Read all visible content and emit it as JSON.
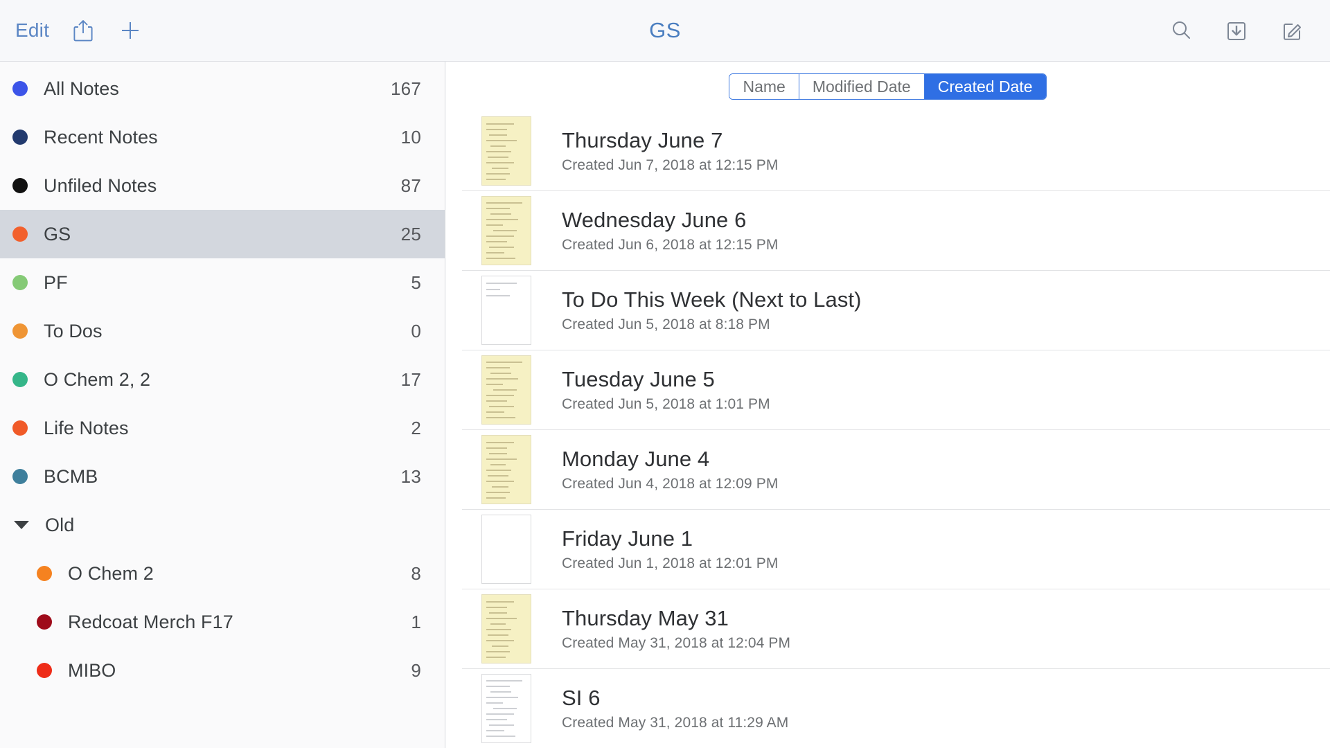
{
  "toolbar": {
    "edit_label": "Edit",
    "share_icon": "share-icon",
    "add_icon": "plus-icon",
    "title": "GS",
    "search_icon": "search-icon",
    "import_icon": "import-download-icon",
    "compose_icon": "compose-icon"
  },
  "sidebar": {
    "items": [
      {
        "label": "All Notes",
        "count": "167",
        "color": "#3c54e8",
        "selected": false,
        "kind": "item"
      },
      {
        "label": "Recent Notes",
        "count": "10",
        "color": "#223a6e",
        "selected": false,
        "kind": "item"
      },
      {
        "label": "Unfiled Notes",
        "count": "87",
        "color": "#111111",
        "selected": false,
        "kind": "item"
      },
      {
        "label": "GS",
        "count": "25",
        "color": "#f2602c",
        "selected": true,
        "kind": "item"
      },
      {
        "label": "PF",
        "count": "5",
        "color": "#85ca76",
        "selected": false,
        "kind": "item"
      },
      {
        "label": "To Dos",
        "count": "0",
        "color": "#ef9535",
        "selected": false,
        "kind": "item"
      },
      {
        "label": "O Chem 2, 2",
        "count": "17",
        "color": "#35b689",
        "selected": false,
        "kind": "item"
      },
      {
        "label": "Life Notes",
        "count": "2",
        "color": "#f05a28",
        "selected": false,
        "kind": "item"
      },
      {
        "label": "BCMB",
        "count": "13",
        "color": "#3e7f9c",
        "selected": false,
        "kind": "item"
      },
      {
        "label": "Old",
        "count": "",
        "color": "",
        "selected": false,
        "kind": "group"
      },
      {
        "label": "O Chem 2",
        "count": "8",
        "color": "#f58220",
        "selected": false,
        "kind": "child"
      },
      {
        "label": "Redcoat Merch F17",
        "count": "1",
        "color": "#9e0b1a",
        "selected": false,
        "kind": "child"
      },
      {
        "label": "MIBO",
        "count": "9",
        "color": "#ee2c18",
        "selected": false,
        "kind": "child"
      }
    ]
  },
  "sort_control": {
    "options": [
      "Name",
      "Modified Date",
      "Created Date"
    ],
    "selected": "Created Date"
  },
  "notes": [
    {
      "title": "Thursday June 7",
      "subtitle": "Created Jun 7, 2018 at 12:15 PM",
      "thumb": "yellow"
    },
    {
      "title": "Wednesday June 6",
      "subtitle": "Created Jun 6, 2018 at 12:15 PM",
      "thumb": "yellow"
    },
    {
      "title": "To Do This Week (Next to Last)",
      "subtitle": "Created Jun 5, 2018 at 8:18 PM",
      "thumb": "white"
    },
    {
      "title": "Tuesday June 5",
      "subtitle": "Created Jun 5, 2018 at 1:01 PM",
      "thumb": "yellow"
    },
    {
      "title": "Monday June 4",
      "subtitle": "Created Jun 4, 2018 at 12:09 PM",
      "thumb": "yellow"
    },
    {
      "title": "Friday June 1",
      "subtitle": "Created Jun 1, 2018 at 12:01 PM",
      "thumb": "white"
    },
    {
      "title": "Thursday May 31",
      "subtitle": "Created May 31, 2018 at 12:04 PM",
      "thumb": "yellow"
    },
    {
      "title": "SI 6",
      "subtitle": "Created May 31, 2018 at 11:29 AM",
      "thumb": "white"
    }
  ],
  "colors": {
    "accent_blue": "#2f6fe4",
    "toolbar_bg": "#f7f8fa",
    "sidebar_bg": "#fafafb",
    "selected_row": "#d3d7de"
  }
}
